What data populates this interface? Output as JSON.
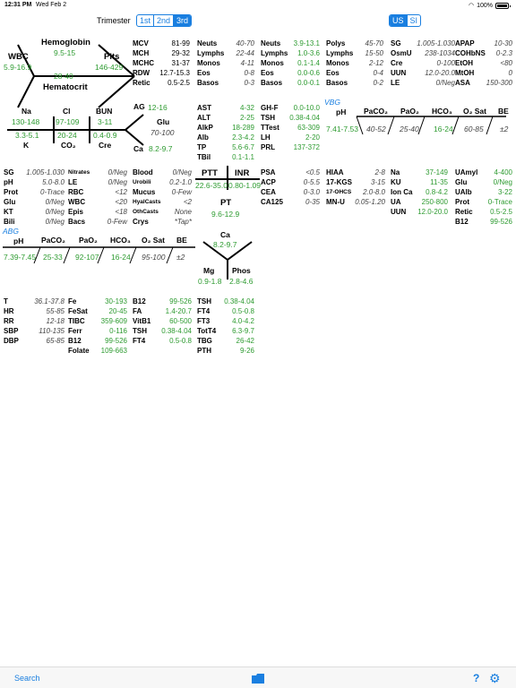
{
  "status": {
    "time": "12:31 PM",
    "date": "Wed Feb 2",
    "battery": "100%"
  },
  "toolbar": {
    "trimester_label": "Trimester",
    "trimesters": [
      "1st",
      "2nd",
      "3rd"
    ],
    "units": [
      "US",
      "SI"
    ]
  },
  "cbc": {
    "hemoglobin": "Hemoglobin",
    "hemoglobin_range": "9.5-15",
    "wbc": "WBC",
    "wbc_range": "5.9-16.9",
    "plts": "Plts",
    "plts_range": "146-429",
    "hematocrit": "Hematocrit",
    "hematocrit_range": "28-40"
  },
  "indices": {
    "col1": [
      [
        "MCV",
        "81-99"
      ],
      [
        "MCH",
        "29-32"
      ],
      [
        "MCHC",
        "31-37"
      ],
      [
        "RDW",
        "12.7-15.3"
      ],
      [
        "Retic",
        "0.5-2.5"
      ]
    ],
    "col2": [
      [
        "Neuts",
        "40-70"
      ],
      [
        "Lymphs",
        "22-44"
      ],
      [
        "Monos",
        "4-11"
      ],
      [
        "Eos",
        "0-8"
      ],
      [
        "Basos",
        "0-3"
      ]
    ],
    "col3": [
      [
        "Neuts",
        "3.9-13.1"
      ],
      [
        "Lymphs",
        "1.0-3.6"
      ],
      [
        "Monos",
        "0.1-1.4"
      ],
      [
        "Eos",
        "0.0-0.6"
      ],
      [
        "Basos",
        "0.0-0.1"
      ]
    ],
    "col4": [
      [
        "Polys",
        "45-70"
      ],
      [
        "Lymphs",
        "15-50"
      ],
      [
        "Monos",
        "2-12"
      ],
      [
        "Eos",
        "0-4"
      ],
      [
        "Basos",
        "0-2"
      ]
    ],
    "col5": [
      [
        "SG",
        "1.005-1.030"
      ],
      [
        "OsmU",
        "238-1034"
      ],
      [
        "Cre",
        "0-100"
      ],
      [
        "UUN",
        "12.0-20.0"
      ],
      [
        "LE",
        "0/Neg"
      ]
    ],
    "col6": [
      [
        "APAP",
        "10-30"
      ],
      [
        "COHbNS",
        "0-2.3"
      ],
      [
        "EtOH",
        "<80"
      ],
      [
        "MtOH",
        "0"
      ],
      [
        "ASA",
        "150-300"
      ]
    ]
  },
  "bmp": {
    "na": "Na",
    "na_range": "130-148",
    "cl": "Cl",
    "cl_range": "97-109",
    "bun": "BUN",
    "bun_range": "3-11",
    "k": "K",
    "k_range": "3.3-5.1",
    "co2": "CO₂",
    "co2_range": "20-24",
    "cre": "Cre",
    "cre_range": "0.4-0.9",
    "glu": "Glu",
    "glu_range": "70-100",
    "ag": "AG",
    "ag_range": "12-16",
    "ca": "Ca",
    "ca_range": "8.2-9.7"
  },
  "lft": {
    "col1": [
      [
        "AST",
        "4-32"
      ],
      [
        "ALT",
        "2-25"
      ],
      [
        "AlkP",
        "18-289"
      ],
      [
        "Alb",
        "2.3-4.2"
      ],
      [
        "TP",
        "5.6-6.7"
      ],
      [
        "TBil",
        "0.1-1.1"
      ]
    ],
    "col2": [
      [
        "GH-F",
        "0.0-10.0"
      ],
      [
        "TSH",
        "0.38-4.04"
      ],
      [
        "TTest",
        "63-309"
      ],
      [
        "LH",
        "2-20"
      ],
      [
        "PRL",
        "137-372"
      ]
    ]
  },
  "vbg": {
    "tag": "VBG",
    "headers": [
      "pH",
      "PaCO₂",
      "PaO₂",
      "HCO₃",
      "O₂ Sat",
      "BE"
    ],
    "values": [
      "7.41-7.53",
      "40-52",
      "25-40",
      "16-24",
      "60-85",
      "±2"
    ]
  },
  "ua": {
    "col1": [
      [
        "SG",
        "1.005-1.030"
      ],
      [
        "pH",
        "5.0-8.0"
      ],
      [
        "Prot",
        "0-Trace"
      ],
      [
        "Glu",
        "0/Neg"
      ],
      [
        "KT",
        "0/Neg"
      ],
      [
        "Bili",
        "0/Neg"
      ]
    ],
    "col2": [
      [
        "Nitrates",
        "0/Neg"
      ],
      [
        "LE",
        "0/Neg"
      ],
      [
        "RBC",
        "<12"
      ],
      [
        "WBC",
        "<20"
      ],
      [
        "Epis",
        "<18"
      ],
      [
        "Bacs",
        "0-Few"
      ]
    ],
    "col3": [
      [
        "Blood",
        "0/Neg"
      ],
      [
        "Urobili",
        "0.2-1.0"
      ],
      [
        "Mucus",
        "0-Few"
      ],
      [
        "HyalCasts",
        "<2"
      ],
      [
        "OthCasts",
        "None"
      ],
      [
        "Crys",
        "*Tap*"
      ]
    ]
  },
  "coag": {
    "ptt": "PTT",
    "ptt_range": "22.6-35.0",
    "inr": "INR",
    "inr_range": "0.80-1.09",
    "pt": "PT",
    "pt_range": "9.6-12.9"
  },
  "tumor": [
    [
      "PSA",
      "<0.5"
    ],
    [
      "ACP",
      "0-5.5"
    ],
    [
      "CEA",
      "0-3.0"
    ],
    [
      "CA125",
      "0-35"
    ]
  ],
  "urine24": [
    [
      "HIAA",
      "2-8"
    ],
    [
      "17-KGS",
      "3-15"
    ],
    [
      "17-OHCS",
      "2.0-8.0"
    ],
    [
      "MN-U",
      "0.05-1.20"
    ]
  ],
  "misc1": [
    [
      "Na",
      "37-149"
    ],
    [
      "KU",
      "11-35"
    ],
    [
      "Ion Ca",
      "0.8-4.2"
    ],
    [
      "UA",
      "250-800"
    ],
    [
      "UUN",
      "12.0-20.0"
    ]
  ],
  "misc2": [
    [
      "UAmyl",
      "4-400"
    ],
    [
      "Glu",
      "0/Neg"
    ],
    [
      "UAlb",
      "3-22"
    ],
    [
      "Prot",
      "0-Trace"
    ],
    [
      "Retic",
      "0.5-2.5"
    ],
    [
      "B12",
      "99-526"
    ]
  ],
  "abg": {
    "tag": "ABG",
    "headers": [
      "pH",
      "PaCO₂",
      "PaO₂",
      "HCO₃",
      "O₂ Sat",
      "BE"
    ],
    "values": [
      "7.39-7.45",
      "25-33",
      "92-107",
      "16-24",
      "95-100",
      "±2"
    ]
  },
  "mineral": {
    "ca": "Ca",
    "ca_range": "8.2-9.7",
    "mg": "Mg",
    "mg_range": "0.9-1.8",
    "phos": "Phos",
    "phos_range": "2.8-4.6"
  },
  "vitals": [
    [
      "T",
      "36.1-37.8"
    ],
    [
      "HR",
      "55-85"
    ],
    [
      "RR",
      "12-18"
    ],
    [
      "SBP",
      "110-135"
    ],
    [
      "DBP",
      "65-85"
    ]
  ],
  "iron": [
    [
      "Fe",
      "30-193"
    ],
    [
      "FeSat",
      "20-45"
    ],
    [
      "TIBC",
      "359-609"
    ],
    [
      "Ferr",
      "0-116"
    ],
    [
      "B12",
      "99-526"
    ],
    [
      "Folate",
      "109-663"
    ]
  ],
  "vit": [
    [
      "B12",
      "99-526"
    ],
    [
      "FA",
      "1.4-20.7"
    ],
    [
      "VitB1",
      "60-500"
    ],
    [
      "TSH",
      "0.38-4.04"
    ],
    [
      "FT4",
      "0.5-0.8"
    ]
  ],
  "thyroid": [
    [
      "TSH",
      "0.38-4.04"
    ],
    [
      "FT4",
      "0.5-0.8"
    ],
    [
      "FT3",
      "4.0-4.2"
    ],
    [
      "TotT4",
      "6.3-9.7"
    ],
    [
      "TBG",
      "26-42"
    ],
    [
      "PTH",
      "9-26"
    ]
  ],
  "bottom": {
    "search": "Search"
  }
}
